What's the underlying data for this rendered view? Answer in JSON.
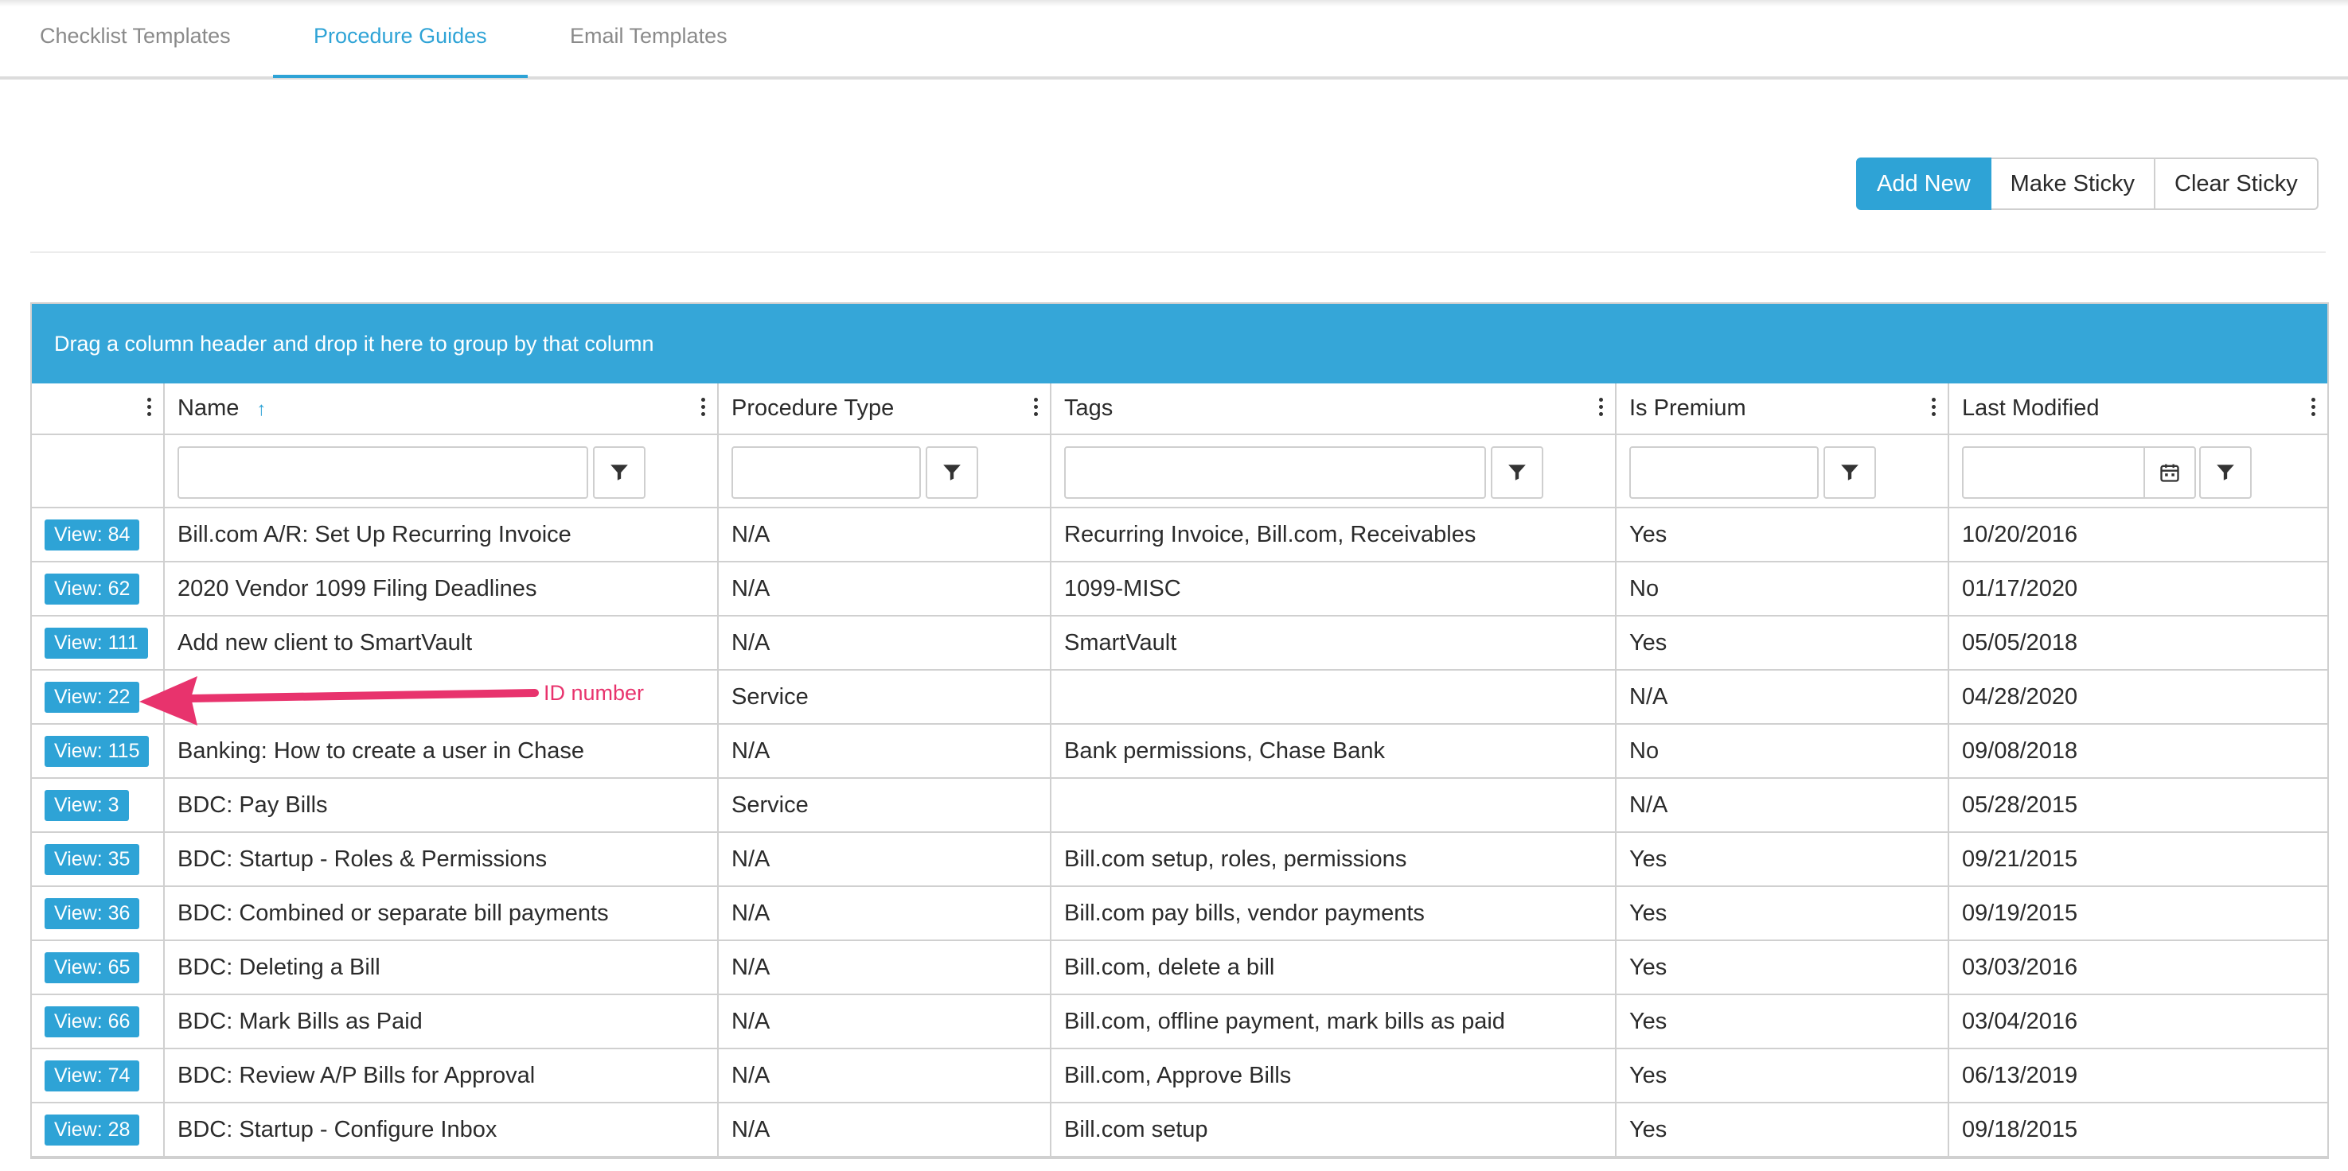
{
  "tabs": [
    {
      "label": "Checklist Templates"
    },
    {
      "label": "Procedure Guides",
      "active": true
    },
    {
      "label": "Email Templates"
    }
  ],
  "toolbar": {
    "add_new": "Add New",
    "make_sticky": "Make Sticky",
    "clear_sticky": "Clear Sticky"
  },
  "grid": {
    "group_bar": "Drag a column header and drop it here to group by that column",
    "columns": [
      {
        "label": ""
      },
      {
        "label": "Name",
        "sort": "ascending"
      },
      {
        "label": "Procedure Type"
      },
      {
        "label": "Tags"
      },
      {
        "label": "Is Premium"
      },
      {
        "label": "Last Modified"
      }
    ],
    "sort_icon": "arrow-up-icon",
    "filter_icon": "funnel-icon",
    "calendar_icon": "calendar-icon",
    "rows": [
      {
        "view": "View: 84",
        "name": "Bill.com A/R: Set Up Recurring Invoice",
        "type": "N/A",
        "tags": "Recurring Invoice, Bill.com, Receivables",
        "premium": "Yes",
        "modified": "10/20/2016"
      },
      {
        "view": "View: 62",
        "name": "2020 Vendor 1099 Filing Deadlines",
        "type": "N/A",
        "tags": "1099-MISC",
        "premium": "No",
        "modified": "01/17/2020"
      },
      {
        "view": "View: 111",
        "name": "Add new client to SmartVault",
        "type": "N/A",
        "tags": "SmartVault",
        "premium": "Yes",
        "modified": "05/05/2018"
      },
      {
        "view": "View: 22",
        "name": "",
        "type": "Service",
        "tags": "",
        "premium": "N/A",
        "modified": "04/28/2020"
      },
      {
        "view": "View: 115",
        "name": "Banking: How to create a user in Chase",
        "type": "N/A",
        "tags": "Bank permissions, Chase Bank",
        "premium": "No",
        "modified": "09/08/2018"
      },
      {
        "view": "View: 3",
        "name": "BDC: Pay Bills",
        "type": "Service",
        "tags": "",
        "premium": "N/A",
        "modified": "05/28/2015"
      },
      {
        "view": "View: 35",
        "name": "BDC: Startup - Roles & Permissions",
        "type": "N/A",
        "tags": "Bill.com setup, roles, permissions",
        "premium": "Yes",
        "modified": "09/21/2015"
      },
      {
        "view": "View: 36",
        "name": "BDC: Combined or separate bill payments",
        "type": "N/A",
        "tags": "Bill.com pay bills, vendor payments",
        "premium": "Yes",
        "modified": "09/19/2015"
      },
      {
        "view": "View: 65",
        "name": "BDC: Deleting a Bill",
        "type": "N/A",
        "tags": "Bill.com, delete a bill",
        "premium": "Yes",
        "modified": "03/03/2016"
      },
      {
        "view": "View: 66",
        "name": "BDC: Mark Bills as Paid",
        "type": "N/A",
        "tags": "Bill.com, offline payment, mark bills as paid",
        "premium": "Yes",
        "modified": "03/04/2016"
      },
      {
        "view": "View: 74",
        "name": "BDC: Review A/P Bills for Approval",
        "type": "N/A",
        "tags": "Bill.com, Approve Bills",
        "premium": "Yes",
        "modified": "06/13/2019"
      },
      {
        "view": "View: 28",
        "name": "BDC: Startup - Configure Inbox",
        "type": "N/A",
        "tags": "Bill.com setup",
        "premium": "Yes",
        "modified": "09/18/2015"
      }
    ]
  },
  "annotation": {
    "label": "ID number",
    "color": "#e8336d"
  },
  "colors": {
    "accent": "#2ea3d6",
    "group_bar": "#35a6d8"
  }
}
